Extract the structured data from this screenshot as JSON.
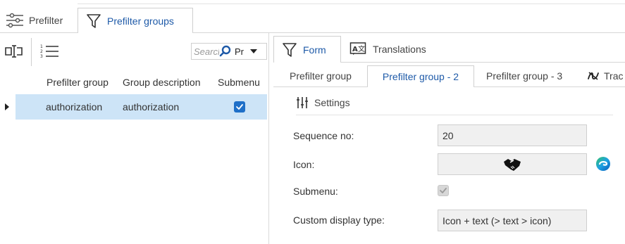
{
  "top_tabs": [
    {
      "label": "Prefilter",
      "icon": "sliders-icon"
    },
    {
      "label": "Prefilter groups",
      "icon": "filter-icon",
      "active": true
    }
  ],
  "toolbar": {
    "search_placeholder": "Search",
    "search_mode": "Pr"
  },
  "grid": {
    "columns": [
      "Prefilter group",
      "Group description",
      "Submenu"
    ],
    "rows": [
      {
        "prefilter_group": "authorization",
        "group_description": "authorization",
        "submenu": true,
        "selected": true
      }
    ]
  },
  "form_tabs": [
    {
      "label": "Form",
      "icon": "filter-icon",
      "active": true
    },
    {
      "label": "Translations",
      "icon": "translate-icon"
    }
  ],
  "sub_tabs": [
    {
      "label": "Prefilter group"
    },
    {
      "label": "Prefilter group - 2",
      "active": true
    },
    {
      "label": "Prefilter group - 3"
    },
    {
      "label": "Trac"
    }
  ],
  "form": {
    "section_title": "Settings",
    "sequence_label": "Sequence no:",
    "sequence_value": "20",
    "icon_label": "Icon:",
    "icon_value": "handshake-icon",
    "submenu_label": "Submenu:",
    "submenu_checked": true,
    "display_type_label": "Custom display type:",
    "display_type_value": "Icon + text (> text > icon)"
  },
  "colors": {
    "accent": "#1e5aa8",
    "selected_row": "#cde4f7",
    "checkbox": "#1e6fc8"
  }
}
